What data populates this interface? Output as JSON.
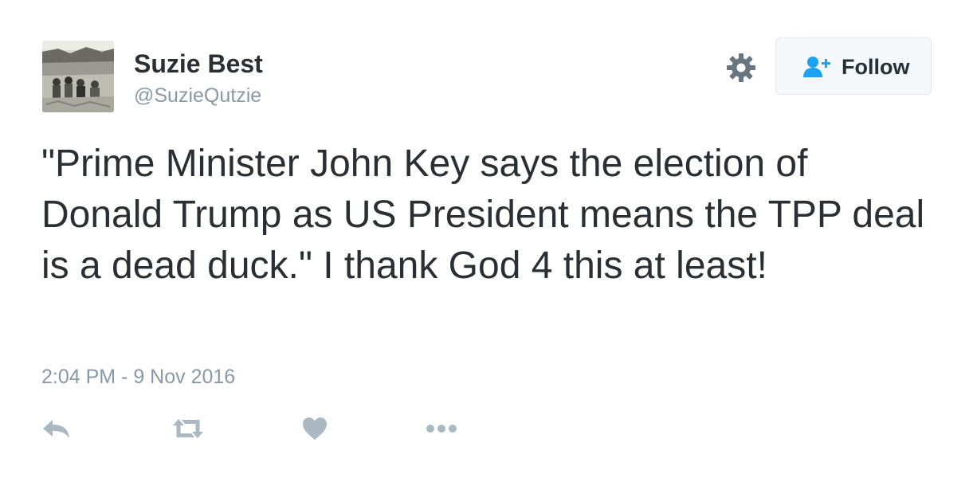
{
  "author": {
    "display_name": "Suzie Best",
    "handle": "@SuzieQutzie"
  },
  "header": {
    "settings_icon": "gear-icon",
    "follow_button": {
      "label": "Follow",
      "icon": "add-user-icon",
      "accent_color": "#1da1f2"
    }
  },
  "tweet": {
    "text": "\"Prime Minister John Key says the election of Donald Trump as US President means the TPP deal is a dead duck.\" I thank God 4 this at least!",
    "timestamp": "2:04 PM - 9 Nov 2016"
  },
  "actions": [
    {
      "name": "reply",
      "icon": "reply-icon"
    },
    {
      "name": "retweet",
      "icon": "retweet-icon"
    },
    {
      "name": "like",
      "icon": "heart-icon"
    },
    {
      "name": "more",
      "icon": "more-dots-icon"
    }
  ],
  "colors": {
    "text": "#292f33",
    "secondary_text": "#8899a6",
    "action_icons": "#aab8c2",
    "button_bg": "#f5f8fa",
    "button_border": "#e1e8ed"
  }
}
